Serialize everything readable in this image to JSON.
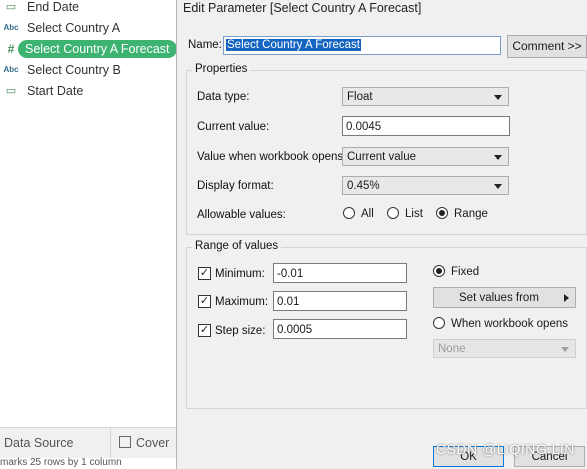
{
  "left_pane": {
    "items": [
      {
        "type_badge": "cal",
        "label": "End Date"
      },
      {
        "type_badge": "Abc",
        "label": "Select Country A"
      },
      {
        "type_badge": "#",
        "label": "Select Country A Forecast",
        "selected": true
      },
      {
        "type_badge": "Abc",
        "label": "Select Country B"
      },
      {
        "type_badge": "cal",
        "label": "Start Date"
      }
    ],
    "tabs": {
      "data_source": "Data Source",
      "cover": "Cover"
    },
    "status": "marks    25 rows by 1 column"
  },
  "dialog": {
    "title": "Edit Parameter [Select Country A Forecast]",
    "name_label": "Name:",
    "name_value": "Select Country A Forecast",
    "comment_button": "Comment >>",
    "properties": {
      "group_title": "Properties",
      "data_type_label": "Data type:",
      "data_type_value": "Float",
      "current_value_label": "Current value:",
      "current_value": "0.0045",
      "workbook_opens_label": "Value when workbook opens:",
      "workbook_opens_value": "Current value",
      "display_format_label": "Display format:",
      "display_format_value": "0.45%",
      "allowable_label": "Allowable values:",
      "allowable_options": [
        "All",
        "List",
        "Range"
      ],
      "allowable_selected": "Range"
    },
    "range": {
      "group_title": "Range of values",
      "minimum_label": "Minimum:",
      "minimum_value": "-0.01",
      "minimum_checked": true,
      "maximum_label": "Maximum:",
      "maximum_value": "0.01",
      "maximum_checked": true,
      "step_label": "Step size:",
      "step_value": "0.0005",
      "step_checked": true,
      "fixed_label": "Fixed",
      "set_values_button": "Set values from",
      "when_opens_label": "When workbook opens",
      "when_opens_value": "None"
    },
    "ok_button": "OK",
    "cancel_button": "Cancel"
  },
  "watermark": "CSDN @LIQING LIN",
  "colors": {
    "selected_pill": "#3cb371",
    "name_highlight": "#1565c0"
  }
}
